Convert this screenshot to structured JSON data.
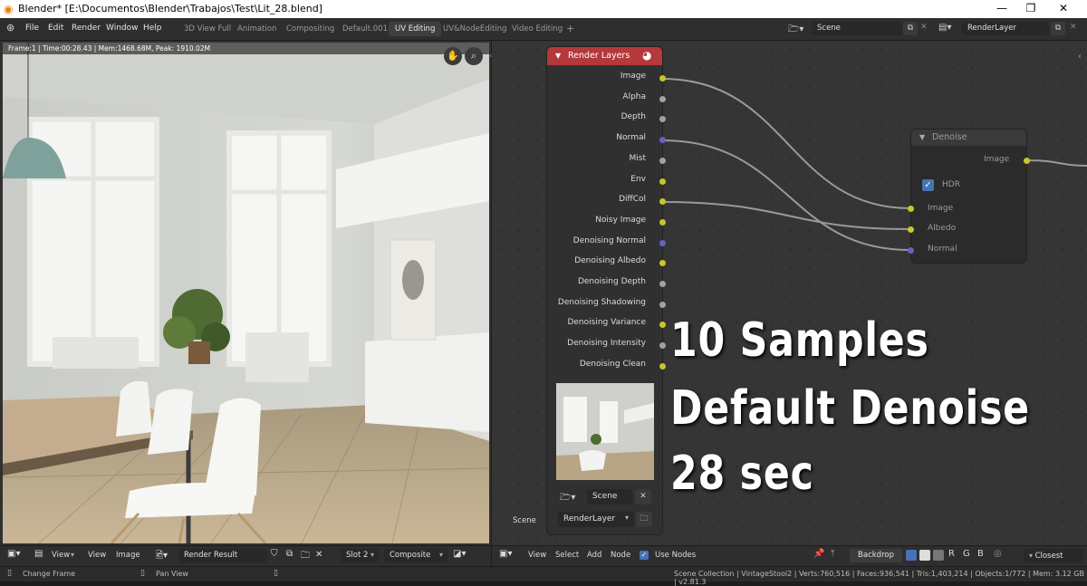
{
  "window": {
    "title": "Blender* [E:\\Documentos\\Blender\\Trabajos\\Test\\Lit_28.blend]"
  },
  "menu": {
    "items": [
      "File",
      "Edit",
      "Render",
      "Window",
      "Help"
    ]
  },
  "workspaces": {
    "tabs": [
      "3D View Full",
      "Animation",
      "Compositing",
      "Default.001",
      "UV Editing",
      "UV&NodeEditing",
      "Video Editing"
    ],
    "active": "UV Editing"
  },
  "scene": {
    "name": "Scene",
    "view_layer": "RenderLayer"
  },
  "image_editor": {
    "frame_info": "Frame:1 | Time:00:28.43 | Mem:1468.68M, Peak: 1910.02M",
    "header": {
      "view": "View",
      "view2": "View",
      "image": "Image",
      "image_name": "Render Result",
      "slot": "Slot 2",
      "pass": "Composite"
    }
  },
  "render_layers_node": {
    "title": "Render Layers",
    "outputs": [
      {
        "label": "Image",
        "color": "#c7c729"
      },
      {
        "label": "Alpha",
        "color": "#a1a1a1"
      },
      {
        "label": "Depth",
        "color": "#a1a1a1"
      },
      {
        "label": "Normal",
        "color": "#6363c7"
      },
      {
        "label": "Mist",
        "color": "#a1a1a1"
      },
      {
        "label": "Env",
        "color": "#c7c729"
      },
      {
        "label": "DiffCol",
        "color": "#c7c729"
      },
      {
        "label": "Noisy Image",
        "color": "#c7c729"
      },
      {
        "label": "Denoising Normal",
        "color": "#6363c7"
      },
      {
        "label": "Denoising Albedo",
        "color": "#c7c729"
      },
      {
        "label": "Denoising Depth",
        "color": "#a1a1a1"
      },
      {
        "label": "Denoising Shadowing",
        "color": "#a1a1a1"
      },
      {
        "label": "Denoising Variance",
        "color": "#c7c729"
      },
      {
        "label": "Denoising Intensity",
        "color": "#a1a1a1"
      },
      {
        "label": "Denoising Clean",
        "color": "#c7c729"
      }
    ],
    "scene_field": "Scene",
    "layer_field": "RenderLayer",
    "scene_label": "Scene"
  },
  "denoise_node": {
    "title": "Denoise",
    "output": "Image",
    "hdr_label": "HDR",
    "hdr_checked": true,
    "inputs": [
      "Image",
      "Albedo",
      "Normal"
    ]
  },
  "overlay": {
    "line1": "10 Samples",
    "line2": "Default Denoise",
    "line3": "28 sec"
  },
  "node_editor_header": {
    "view": "View",
    "select": "Select",
    "add": "Add",
    "node": "Node",
    "use_nodes": "Use Nodes",
    "use_nodes_checked": true,
    "backdrop": "Backdrop",
    "channels": [
      "R",
      "G",
      "B"
    ],
    "interp": "Closest"
  },
  "status": {
    "change_frame": "Change Frame",
    "pan_view": "Pan View",
    "stats": "Scene Collection | VintageStool2 | Verts:760,516 | Faces:936,541 | Tris:1,403,214 | Objects:1/772 | Mem: 3.12 GB | v2.81.3"
  },
  "colors": {
    "accent": "#b5383b",
    "node_header_red": "#b5383b",
    "link_highlight": "#e03a3a",
    "checkbox": "#4772b3"
  }
}
